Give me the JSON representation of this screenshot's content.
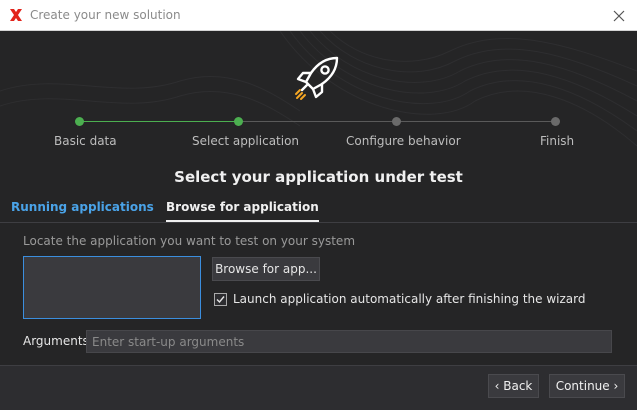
{
  "window": {
    "title": "Create your new solution"
  },
  "steps": [
    {
      "label": "Basic data",
      "state": "done"
    },
    {
      "label": "Select application",
      "state": "current"
    },
    {
      "label": "Configure behavior",
      "state": "pending"
    },
    {
      "label": "Finish",
      "state": "pending"
    }
  ],
  "heading": "Select your application under test",
  "tabs": [
    {
      "label": "Running applications",
      "active": false
    },
    {
      "label": "Browse for application",
      "active": true
    }
  ],
  "panel": {
    "locate_text": "Locate the application you want to test on your system",
    "browse_button": "Browse for app...",
    "launch_checkbox": {
      "label": "Launch application automatically after finishing the wizard",
      "checked": true
    },
    "arguments": {
      "label": "Arguments",
      "value": "",
      "placeholder": "Enter start-up arguments"
    }
  },
  "footer": {
    "back": "‹ Back",
    "continue": "Continue ›"
  },
  "colors": {
    "accent_blue": "#4aa3e8",
    "step_done": "#4caf50",
    "step_pending": "#6a6a6a",
    "app_icon_red": "#e2231a"
  }
}
